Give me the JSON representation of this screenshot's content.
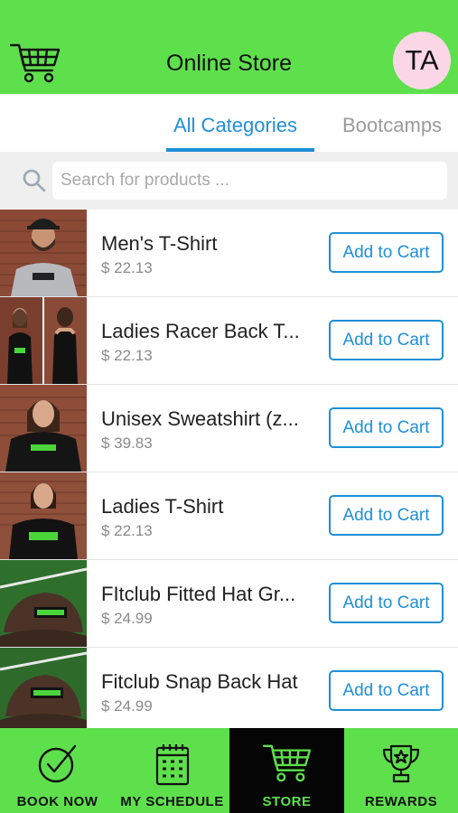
{
  "header": {
    "title": "Online Store",
    "avatar_initials": "TA",
    "cart_icon": "shopping-cart-icon"
  },
  "tabs": [
    {
      "label": "All Categories",
      "active": true
    },
    {
      "label": "Bootcamps",
      "active": false
    }
  ],
  "search": {
    "placeholder": "Search for products ...",
    "value": "",
    "icon": "search-icon"
  },
  "products": [
    {
      "name": "Men's T-Shirt",
      "price": "$ 22.13",
      "button": "Add to Cart",
      "image": "man-in-grey-tshirt-and-cap"
    },
    {
      "name": "Ladies Racer Back T...",
      "price": "$ 22.13",
      "button": "Add to Cart",
      "image": "woman-in-black-racerback-tank"
    },
    {
      "name": "Unisex Sweatshirt (z...",
      "price": "$ 39.83",
      "button": "Add to Cart",
      "image": "woman-in-black-sweatshirt"
    },
    {
      "name": "Ladies T-Shirt",
      "price": "$ 22.13",
      "button": "Add to Cart",
      "image": "woman-in-black-tshirt"
    },
    {
      "name": "FItclub Fitted Hat Gr...",
      "price": "$ 24.99",
      "button": "Add to Cart",
      "image": "fitted-hat-on-turf"
    },
    {
      "name": "Fitclub Snap Back Hat",
      "price": "$ 24.99",
      "button": "Add to Cart",
      "image": "snapback-hat-on-turf"
    }
  ],
  "bottom_nav": [
    {
      "label": "BOOK NOW",
      "icon": "check-circle-icon",
      "active": false
    },
    {
      "label": "MY SCHEDULE",
      "icon": "calendar-icon",
      "active": false
    },
    {
      "label": "STORE",
      "icon": "shopping-cart-icon",
      "active": true
    },
    {
      "label": "REWARDS",
      "icon": "trophy-icon",
      "active": false
    }
  ],
  "colors": {
    "brand_green": "#5ee04c",
    "accent_blue": "#1e8fd8",
    "nav_active_bg": "#050505",
    "avatar_bg": "#fbd7e6"
  }
}
